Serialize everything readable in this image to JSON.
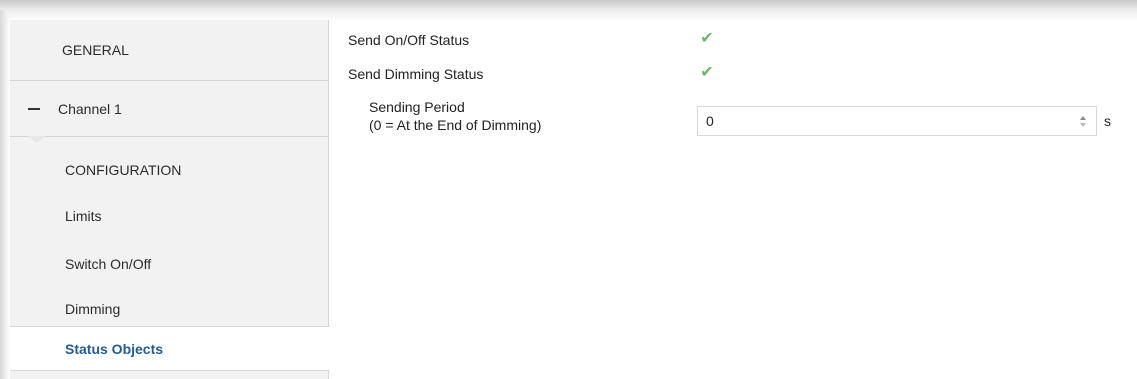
{
  "sidebar": {
    "general": "GENERAL",
    "channel": "Channel 1",
    "items": [
      {
        "label": "CONFIGURATION"
      },
      {
        "label": "Limits"
      },
      {
        "label": "Switch On/Off"
      },
      {
        "label": "Dimming"
      },
      {
        "label": "Status Objects",
        "selected": true
      }
    ]
  },
  "main": {
    "send_onoff_label": "Send On/Off Status",
    "send_onoff_checked": true,
    "send_dimming_label": "Send Dimming Status",
    "send_dimming_checked": true,
    "period_label_line1": "Sending Period",
    "period_label_line2": "(0 = At the End of Dimming)",
    "period_value": "0",
    "period_unit": "s"
  },
  "colors": {
    "sidebar_bg": "#f2f2f2",
    "selected_text": "#1f5c99",
    "check_green": "#6fb36f"
  },
  "icons": {
    "check": "check-icon",
    "collapse": "minus-icon",
    "spinner_up": "triangle-up-icon",
    "spinner_down": "triangle-down-icon"
  }
}
